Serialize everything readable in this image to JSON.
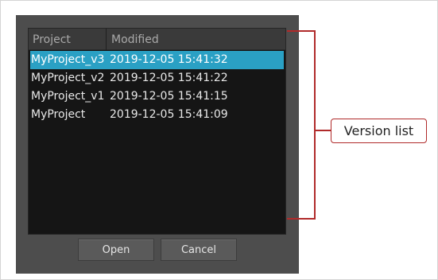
{
  "list": {
    "columns": [
      "Project",
      "Modified"
    ],
    "rows": [
      {
        "project": "MyProject_v3",
        "modified": "2019-12-05 15:41:32",
        "selected": true
      },
      {
        "project": "MyProject_v2",
        "modified": "2019-12-05 15:41:22",
        "selected": false
      },
      {
        "project": "MyProject_v1",
        "modified": "2019-12-05 15:41:15",
        "selected": false
      },
      {
        "project": "MyProject",
        "modified": "2019-12-05 15:41:09",
        "selected": false
      }
    ]
  },
  "buttons": {
    "open_label": "Open",
    "cancel_label": "Cancel"
  },
  "callout": {
    "label": "Version list"
  },
  "colors": {
    "selection": "#2aa0c4",
    "annotation": "#b02a2a",
    "dialog_bg": "#4d4d4d",
    "list_bg": "#151515"
  }
}
